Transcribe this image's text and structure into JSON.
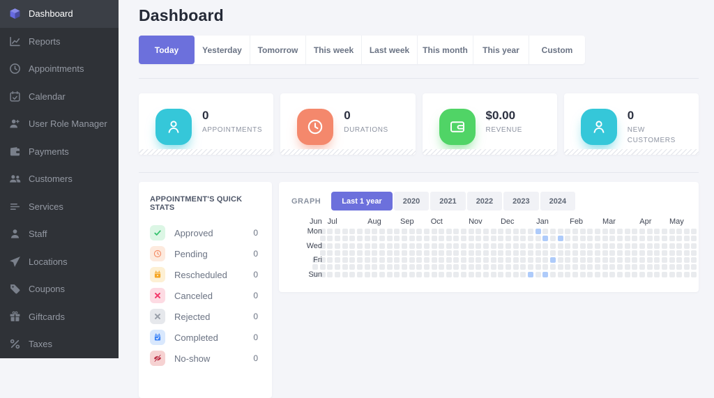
{
  "colors": {
    "accent": "#6c70dc",
    "sidebar_bg": "#2f3237",
    "page_bg": "#f4f5f9",
    "heatmap_empty": "#e9ebee",
    "heatmap_active": "#aecbfa"
  },
  "sidebar": {
    "items": [
      {
        "label": "Dashboard",
        "icon": "cube-icon",
        "active": true
      },
      {
        "label": "Reports",
        "icon": "chart-icon",
        "active": false
      },
      {
        "label": "Appointments",
        "icon": "clock-icon",
        "active": false
      },
      {
        "label": "Calendar",
        "icon": "calendar-icon",
        "active": false
      },
      {
        "label": "User Role Manager",
        "icon": "user-plus-icon",
        "active": false
      },
      {
        "label": "Payments",
        "icon": "wallet-icon",
        "active": false
      },
      {
        "label": "Customers",
        "icon": "users-icon",
        "active": false
      },
      {
        "label": "Services",
        "icon": "list-icon",
        "active": false
      },
      {
        "label": "Staff",
        "icon": "person-icon",
        "active": false
      },
      {
        "label": "Locations",
        "icon": "send-icon",
        "active": false
      },
      {
        "label": "Coupons",
        "icon": "tag-icon",
        "active": false
      },
      {
        "label": "Giftcards",
        "icon": "gift-icon",
        "active": false
      },
      {
        "label": "Taxes",
        "icon": "percent-icon",
        "active": false
      }
    ]
  },
  "header": {
    "title": "Dashboard"
  },
  "filter_tabs": [
    {
      "label": "Today",
      "active": true
    },
    {
      "label": "Yesterday",
      "active": false
    },
    {
      "label": "Tomorrow",
      "active": false
    },
    {
      "label": "This week",
      "active": false
    },
    {
      "label": "Last week",
      "active": false
    },
    {
      "label": "This month",
      "active": false
    },
    {
      "label": "This year",
      "active": false
    },
    {
      "label": "Custom",
      "active": false
    }
  ],
  "stat_cards": [
    {
      "value": "0",
      "label": "APPOINTMENTS",
      "icon": "user-outline-icon",
      "color": "#35c7d9"
    },
    {
      "value": "0",
      "label": "DURATIONS",
      "icon": "clock-outline-icon",
      "color": "#f4886c"
    },
    {
      "value": "$0.00",
      "label": "REVENUE",
      "icon": "wallet-outline-icon",
      "color": "#50d466"
    },
    {
      "value": "0",
      "label": "NEW CUSTOMERS",
      "icon": "user-outline-icon",
      "color": "#35c7d9"
    }
  ],
  "quick_stats": {
    "title": "APPOINTMENT'S QUICK STATS",
    "rows": [
      {
        "label": "Approved",
        "value": "0",
        "icon": "check-icon",
        "fg": "#36c26e",
        "bg": "#dcf6e5"
      },
      {
        "label": "Pending",
        "value": "0",
        "icon": "clock-outline-icon",
        "fg": "#f4875f",
        "bg": "#fdeade"
      },
      {
        "label": "Rescheduled",
        "value": "0",
        "icon": "calendar-filled-icon",
        "fg": "#f5a623",
        "bg": "#fdf0d4"
      },
      {
        "label": "Canceled",
        "value": "0",
        "icon": "x-icon",
        "fg": "#f23b6c",
        "bg": "#fddbe3"
      },
      {
        "label": "Rejected",
        "value": "0",
        "icon": "x-icon",
        "fg": "#9aa0aa",
        "bg": "#e6e8ec"
      },
      {
        "label": "Completed",
        "value": "0",
        "icon": "calendar-check-icon",
        "fg": "#3b82f6",
        "bg": "#d9e8fd"
      },
      {
        "label": "No-show",
        "value": "0",
        "icon": "eye-off-icon",
        "fg": "#bb2d42",
        "bg": "#f6d2d2"
      }
    ]
  },
  "graph": {
    "label": "GRAPH",
    "tabs": [
      {
        "label": "Last 1 year",
        "active": true
      },
      {
        "label": "2020",
        "active": false
      },
      {
        "label": "2021",
        "active": false
      },
      {
        "label": "2022",
        "active": false
      },
      {
        "label": "2023",
        "active": false
      },
      {
        "label": "2024",
        "active": false
      }
    ],
    "heatmap": {
      "rows": 7,
      "cols": 52,
      "day_labels": [
        {
          "label": "Mon",
          "row": 0
        },
        {
          "label": "Wed",
          "row": 2
        },
        {
          "label": "Fri",
          "row": 4
        },
        {
          "label": "Sun",
          "row": 6
        }
      ],
      "month_labels": [
        {
          "label": "Jun",
          "col": 0
        },
        {
          "label": "Jul",
          "col": 2.4
        },
        {
          "label": "Aug",
          "col": 7.8
        },
        {
          "label": "Sep",
          "col": 12.2
        },
        {
          "label": "Oct",
          "col": 16.3
        },
        {
          "label": "Nov",
          "col": 21.4
        },
        {
          "label": "Dec",
          "col": 25.7
        },
        {
          "label": "Jan",
          "col": 30.5
        },
        {
          "label": "Feb",
          "col": 35
        },
        {
          "label": "Mar",
          "col": 39.4
        },
        {
          "label": "Apr",
          "col": 44.4
        },
        {
          "label": "May",
          "col": 48.4
        }
      ],
      "hidden_cells": [
        [
          0,
          0
        ],
        [
          1,
          0
        ],
        [
          2,
          0
        ],
        [
          3,
          0
        ]
      ],
      "active_cells": [
        [
          0,
          30
        ],
        [
          1,
          31
        ],
        [
          1,
          33
        ],
        [
          4,
          32
        ],
        [
          6,
          29
        ],
        [
          6,
          31
        ]
      ]
    }
  }
}
